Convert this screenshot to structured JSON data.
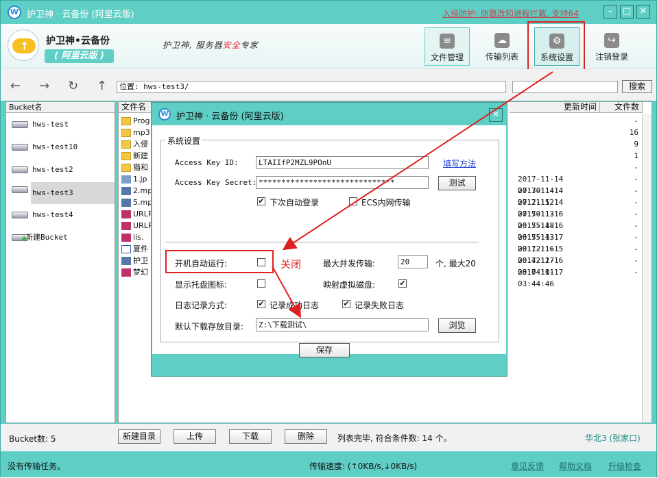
{
  "window": {
    "title": "护卫神 · 云备份 (阿里云版)",
    "top_link": "入侵防护: 防篡改和进程拦截, 支持64",
    "logo_letter": "W"
  },
  "header": {
    "brand_name": "护卫神•云备份",
    "brand_sub": "( 阿里云版 )",
    "slogan_prefix": "护卫神, 服务器",
    "slogan_highlight": "安全",
    "slogan_suffix": "专家",
    "tools": [
      {
        "label": "文件管理",
        "icon": "file-icon"
      },
      {
        "label": "传输列表",
        "icon": "cloud-upload-icon"
      },
      {
        "label": "系统设置",
        "icon": "gear-icon"
      },
      {
        "label": "注销登录",
        "icon": "logout-icon"
      }
    ]
  },
  "nav": {
    "location": "位置: hws-test3/",
    "search_value": "",
    "search_label": "搜索"
  },
  "buckets": {
    "header": "Bucket名",
    "items": [
      "hws-test",
      "hws-test10",
      "hws-test2",
      "hws-test3",
      "hws-test4"
    ],
    "new_bucket": "新建Bucket",
    "selected": "hws-test3"
  },
  "files": {
    "col_name": "文件名",
    "col_time": "更新时间",
    "col_count": "文件数",
    "rows": [
      {
        "name": "Prog",
        "type": "folder",
        "time": "",
        "count": "-"
      },
      {
        "name": "mp3",
        "type": "folder",
        "time": "",
        "count": "16"
      },
      {
        "name": "入侵",
        "type": "folder",
        "time": "",
        "count": "9"
      },
      {
        "name": "新建",
        "type": "folder",
        "time": "",
        "count": "1"
      },
      {
        "name": "猫和",
        "type": "folder",
        "time": "",
        "count": "-"
      },
      {
        "name": "1.jp",
        "type": "jpg",
        "time": "2017-11-14 07:30:14",
        "count": "-"
      },
      {
        "name": "2.mp",
        "type": "mp3",
        "time": "2017-11-14 07:21:52",
        "count": "-"
      },
      {
        "name": "5.mp",
        "type": "mp3",
        "time": "2017-11-14 07:50:13",
        "count": "-"
      },
      {
        "name": "URLR",
        "type": "rar",
        "time": "2017-11-16 06:55:48",
        "count": "-"
      },
      {
        "name": "URLR",
        "type": "rar",
        "time": "2017-11-16 06:55:43",
        "count": "-"
      },
      {
        "name": "iis.",
        "type": "rar",
        "time": "2017-11-17 08:12:16",
        "count": "-"
      },
      {
        "name": "夏件",
        "type": "doc",
        "time": "2017-11-15 06:42:27",
        "count": "-"
      },
      {
        "name": "护卫",
        "type": "mp3",
        "time": "2017-11-16 08:04:01",
        "count": "-"
      },
      {
        "name": "梦幻",
        "type": "rar",
        "time": "2017-11-17 03:44:46",
        "count": "-"
      }
    ]
  },
  "bottom": {
    "bucket_count": "Bucket数: 5",
    "buttons": [
      "新建目录",
      "上传",
      "下载",
      "删除"
    ],
    "list_status": "列表完毕, 符合条件数: 14 个。",
    "region": "华北3 (张家口)"
  },
  "statusbar": {
    "left": "没有传输任务。",
    "speed": "传输速度: (↑0KB/s,↓0KB/s)",
    "links": [
      "意见反馈",
      "帮助文档",
      "升级检查"
    ]
  },
  "dialog": {
    "title": "护卫神 · 云备份 (阿里云版)",
    "group_label": "系统设置",
    "access_key_id_label": "Access Key ID:",
    "access_key_id_value": "LTAIIfP2MZL9POnU",
    "help_link": "填写方法",
    "access_key_secret_label": "Access Key Secret:",
    "access_key_secret_value": "******************************",
    "test_button": "测试",
    "auto_login_label": "下次自动登录",
    "ecs_label": "ECS内网传输",
    "autostart_label": "开机自动运行:",
    "max_concurrent_label": "最大并发传输:",
    "max_concurrent_value": "20",
    "max_concurrent_suffix": "个, 最大20",
    "tray_label": "显示托盘图标:",
    "mount_label": "映射虚拟磁盘:",
    "log_label": "日志记录方式:",
    "log_success_label": "记录成功日志",
    "log_fail_label": "记录失败日志",
    "download_dir_label": "默认下载存放目录:",
    "download_dir_value": "Z:\\下载测试\\",
    "browse_button": "浏览",
    "save_button": "保存",
    "checks": {
      "auto_login": true,
      "ecs": false,
      "autostart": false,
      "tray": false,
      "mount": true,
      "log_success": true,
      "log_fail": true
    }
  },
  "annotation": {
    "text": "关闭",
    "color": "#e02020"
  }
}
